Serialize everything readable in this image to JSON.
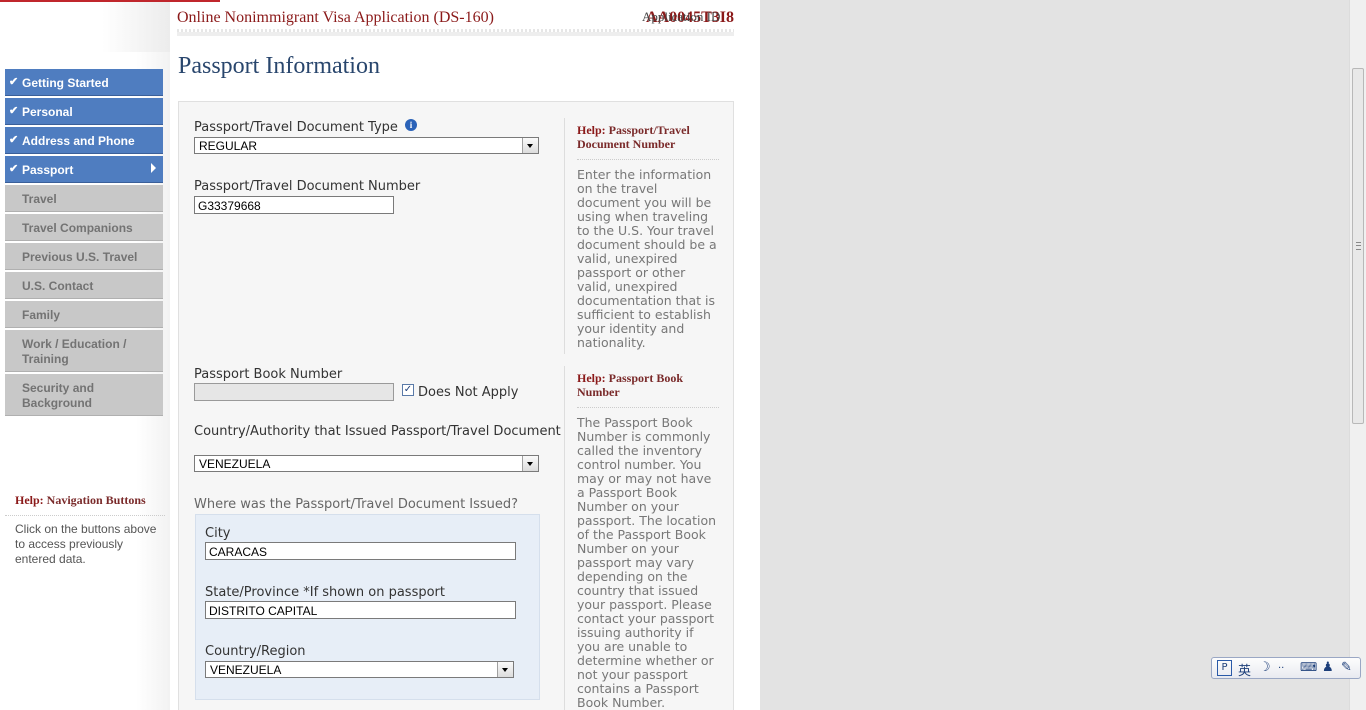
{
  "header": {
    "title": "Online Nonimmigrant Visa Application (DS-160)",
    "app_id_label": "Application ID",
    "app_id_value": "AA0045T3I8"
  },
  "nav": {
    "items": [
      {
        "label": "Getting Started",
        "done": true
      },
      {
        "label": "Personal",
        "done": true
      },
      {
        "label": "Address and Phone",
        "done": true
      },
      {
        "label": "Passport",
        "done": true,
        "current": true
      },
      {
        "label": "Travel",
        "done": false
      },
      {
        "label": "Travel Companions",
        "done": false
      },
      {
        "label": "Previous U.S. Travel",
        "done": false
      },
      {
        "label": "U.S. Contact",
        "done": false
      },
      {
        "label": "Family",
        "done": false
      },
      {
        "label": "Work / Education / Training",
        "done": false
      },
      {
        "label": "Security and Background",
        "done": false
      }
    ],
    "help": {
      "prefix": "Help:",
      "title": "Navigation Buttons",
      "body": "Click on the buttons above to access previously entered data."
    }
  },
  "page_title": "Passport Information",
  "form": {
    "doc_type": {
      "label": "Passport/Travel Document Type",
      "value": "REGULAR"
    },
    "doc_number": {
      "label": "Passport/Travel Document Number",
      "value": "G33379668"
    },
    "book_number": {
      "label": "Passport Book Number",
      "value": "",
      "does_not_apply_label": "Does Not Apply",
      "does_not_apply_checked": true
    },
    "issuing_country": {
      "label": "Country/Authority that Issued Passport/Travel Document",
      "value": "VENEZUELA"
    },
    "issued_where": {
      "label": "Where was the Passport/Travel Document Issued?",
      "city": {
        "label": "City",
        "value": "CARACAS"
      },
      "state": {
        "label": "State/Province *If shown on passport",
        "value": "DISTRITO CAPITAL"
      },
      "country": {
        "label": "Country/Region",
        "value": "VENEZUELA"
      }
    }
  },
  "help_panels": [
    {
      "prefix": "Help:",
      "title": "Passport/Travel Document Number",
      "body": "Enter the information on the travel document you will be using when traveling to the U.S. Your travel document should be a valid, unexpired passport or other valid, unexpired documentation that is sufficient to establish your identity and nationality."
    },
    {
      "prefix": "Help:",
      "title": "Passport Book Number",
      "body": "The Passport Book Number is commonly called the inventory control number. You may or may not have a Passport Book Number on your passport. The location of the Passport Book Number on your passport may vary depending on the country that issued your passport. Please contact your passport issuing authority if you are unable to determine whether or not your passport contains a Passport Book Number."
    }
  ],
  "ime_toolbar": {
    "lang": "英"
  }
}
